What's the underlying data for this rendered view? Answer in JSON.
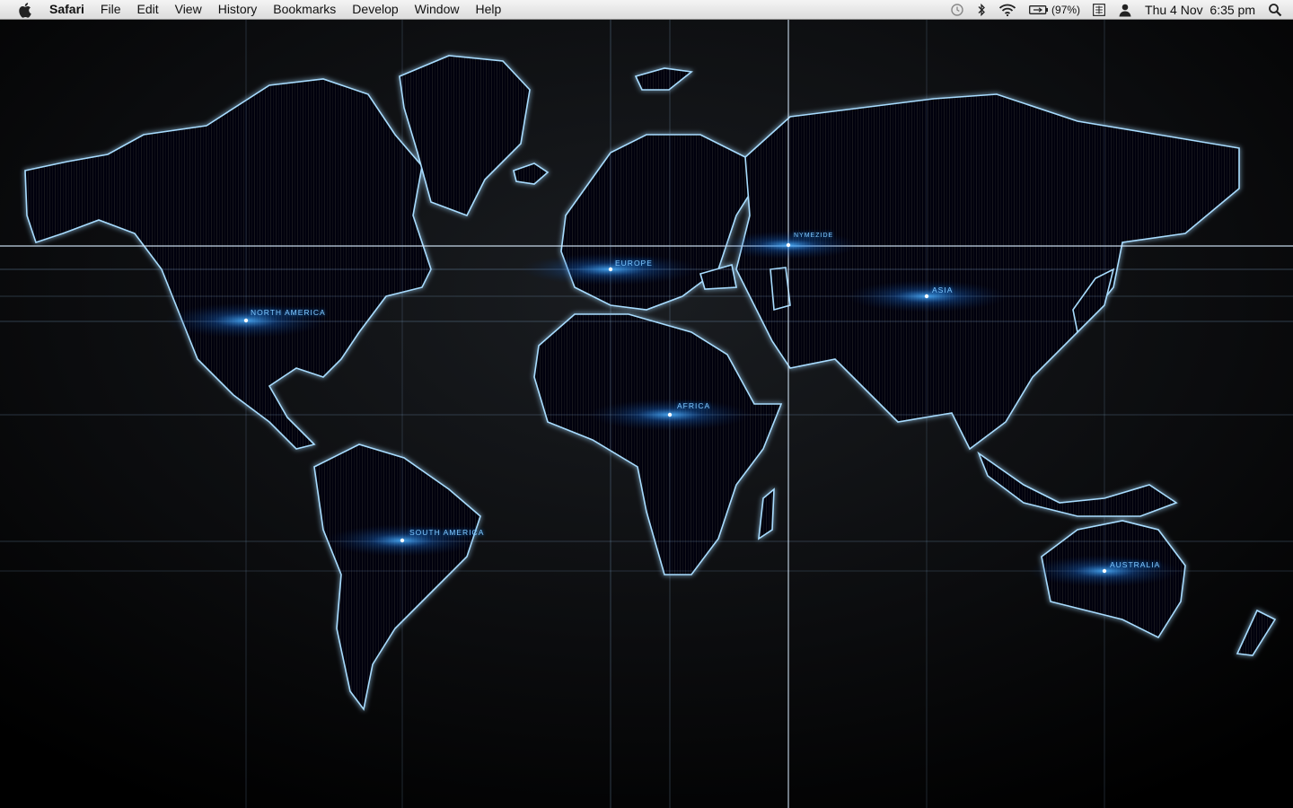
{
  "menubar": {
    "app_name": "Safari",
    "menus": [
      "File",
      "Edit",
      "View",
      "History",
      "Bookmarks",
      "Develop",
      "Window",
      "Help"
    ],
    "status": {
      "time_machine_icon": "time-machine-icon",
      "bluetooth_icon": "bluetooth-icon",
      "wifi_icon": "wifi-icon",
      "battery_icon": "battery-icon",
      "battery_percent": "(97%)",
      "input_menu_icon": "input-menu-icon",
      "user_icon": "user-icon",
      "clock": "Thu 4 Nov  6:35 pm",
      "spotlight_icon": "spotlight-icon"
    }
  },
  "wallpaper": {
    "labels": {
      "north_america": "NORTH AMERICA",
      "europe": "EUROPE",
      "nymezide": "NYMEZIDE",
      "asia": "ASIA",
      "africa": "AFRICA",
      "south_america": "SOUTH AMERICA",
      "australia": "AUSTRALIA"
    },
    "colors": {
      "glow": "#1a8cff",
      "outline": "#9fd6ff",
      "land": "#050709"
    }
  }
}
